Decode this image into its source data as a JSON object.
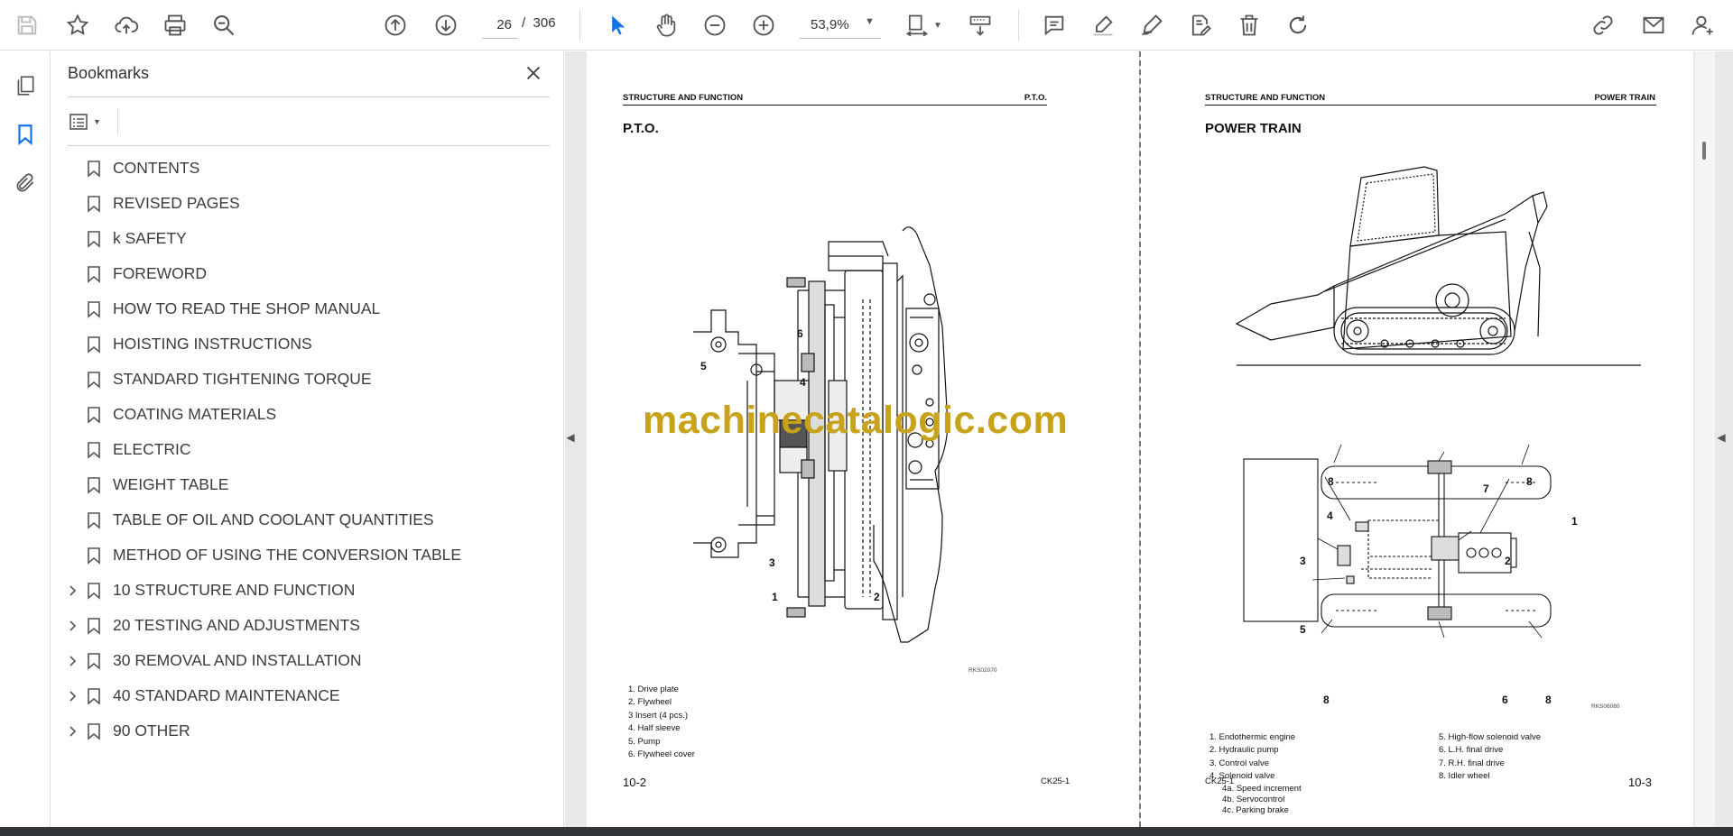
{
  "toolbar": {
    "page_current": "26",
    "page_separator": "/",
    "page_total": "306",
    "zoom": "53,9%"
  },
  "bookmarks": {
    "title": "Bookmarks",
    "items": [
      {
        "label": "CONTENTS",
        "expandable": false
      },
      {
        "label": "REVISED PAGES",
        "expandable": false
      },
      {
        "label": "k SAFETY",
        "expandable": false
      },
      {
        "label": "FOREWORD",
        "expandable": false
      },
      {
        "label": "HOW TO READ THE SHOP MANUAL",
        "expandable": false
      },
      {
        "label": "HOISTING INSTRUCTIONS",
        "expandable": false
      },
      {
        "label": "STANDARD TIGHTENING TORQUE",
        "expandable": false
      },
      {
        "label": "COATING MATERIALS",
        "expandable": false
      },
      {
        "label": "ELECTRIC",
        "expandable": false
      },
      {
        "label": "WEIGHT TABLE",
        "expandable": false
      },
      {
        "label": "TABLE OF OIL AND COOLANT QUANTITIES",
        "expandable": false
      },
      {
        "label": "METHOD OF USING THE CONVERSION TABLE",
        "expandable": false
      },
      {
        "label": "10 STRUCTURE AND FUNCTION",
        "expandable": true
      },
      {
        "label": "20 TESTING AND ADJUSTMENTS",
        "expandable": true
      },
      {
        "label": "30 REMOVAL AND INSTALLATION",
        "expandable": true
      },
      {
        "label": "40 STANDARD MAINTENANCE",
        "expandable": true
      },
      {
        "label": "90 OTHER",
        "expandable": true
      }
    ]
  },
  "page_left": {
    "header_left": "STRUCTURE AND FUNCTION",
    "header_right": "P.T.O.",
    "title": "P.T.O.",
    "figure_code": "RKS02070",
    "callouts": [
      "1",
      "2",
      "3",
      "4",
      "5",
      "6"
    ],
    "legend": [
      "1.  Drive plate",
      "2.  Flywheel",
      "3   Insert (4 pcs.)",
      "4.  Half sleeve",
      "5.  Pump",
      "6.  Flywheel cover"
    ],
    "page_number": "10-2",
    "doc_code": "CK25-1"
  },
  "page_right": {
    "header_left": "STRUCTURE AND FUNCTION",
    "header_right": "POWER TRAIN",
    "title": "POWER TRAIN",
    "figure_code": "RKS06080",
    "legend_col1": [
      "1.  Endothermic engine",
      "2.  Hydraulic pump",
      "3.  Control valve",
      "4.  Solenoid valve",
      "4a.  Speed increment",
      "4b.  Servocontrol",
      "4c.  Parking brake"
    ],
    "legend_col2": [
      "5.  High-flow solenoid valve",
      "6.  L.H. final drive",
      "7.  R.H. final drive",
      "8.  Idler wheel"
    ],
    "page_number": "10-3",
    "doc_code": "CK25-1"
  },
  "watermark": "machinecatalogic.com",
  "colors": {
    "accent": "#1473e6",
    "watermark": "#c8a21a"
  }
}
